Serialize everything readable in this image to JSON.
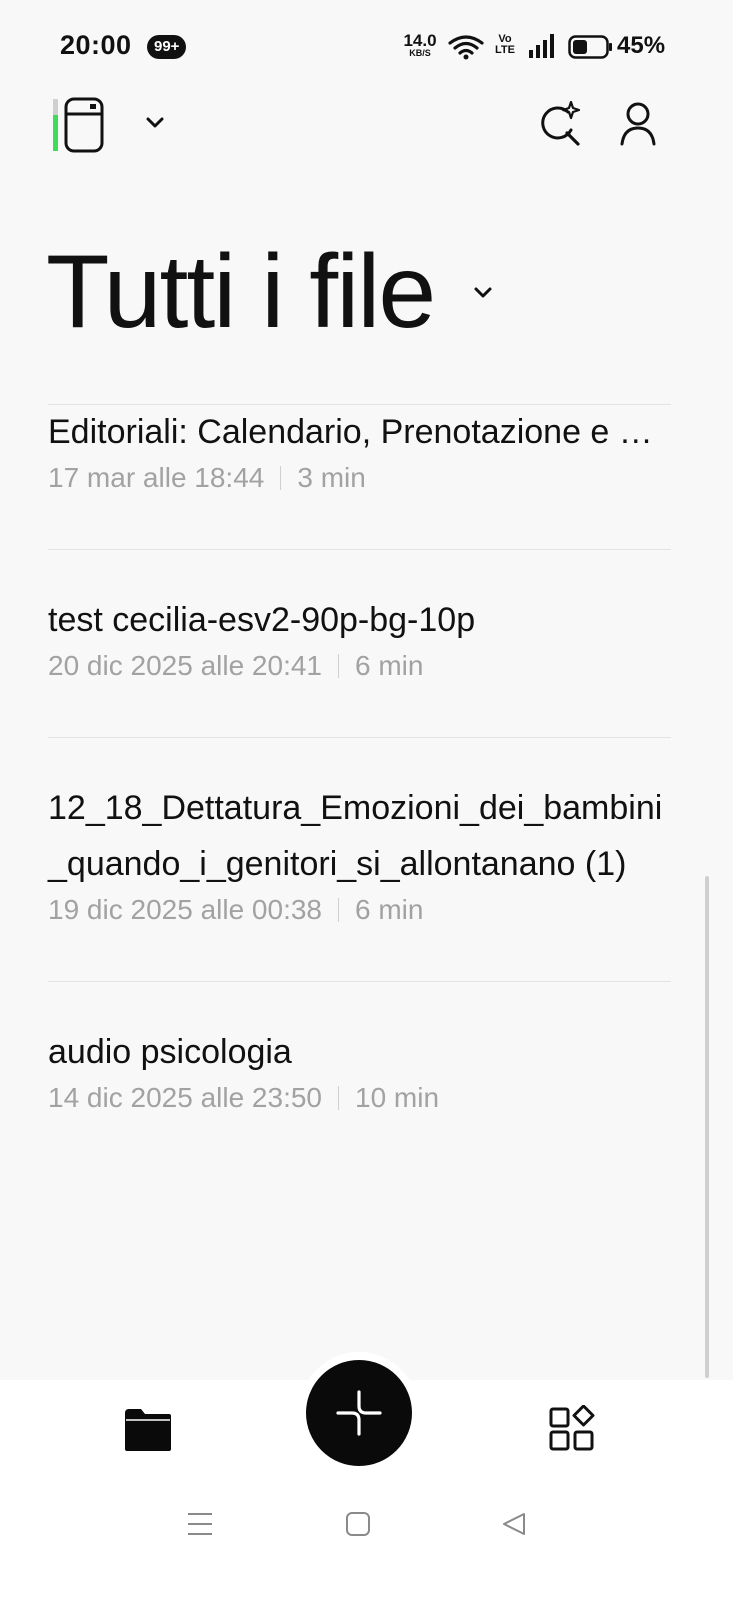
{
  "status_bar": {
    "time": "20:00",
    "notification_badge": "99+",
    "net_speed_value": "14.0",
    "net_speed_unit": "KB/S",
    "volte_top": "Vo",
    "volte_bottom": "LTE",
    "battery_percent": "45%",
    "battery_level": 0.45,
    "icons": [
      "wifi-icon",
      "signal-icon",
      "battery-icon"
    ]
  },
  "header": {
    "logo_icon": "app-logo-icon",
    "dropdown_icon": "chevron-down-icon",
    "search_icon": "sparkle-search-icon",
    "profile_icon": "profile-icon"
  },
  "page": {
    "title": "Tutti i file",
    "title_dropdown_icon": "chevron-down-icon"
  },
  "files": [
    {
      "name": "Editoriali: Calendario, Prenotazione e …",
      "date": "17 mar alle 18:44",
      "duration": "3 min"
    },
    {
      "name": "test cecilia-esv2-90p-bg-10p",
      "date": "20 dic 2025 alle 20:41",
      "duration": "6 min"
    },
    {
      "name": "12_18_Dettatura_Emozioni_dei_bambini_quando_i_genitori_si_allontanano (1)",
      "date": "19 dic 2025 alle 00:38",
      "duration": "6 min"
    },
    {
      "name": "audio psicologia",
      "date": "14 dic 2025 alle 23:50",
      "duration": "10 min"
    }
  ],
  "bottom_nav": {
    "left_icon": "folder-icon",
    "fab_icon": "sparkle-plus-icon",
    "right_icon": "apps-grid-icon"
  },
  "system_nav": [
    "menu-icon",
    "home-icon",
    "back-icon"
  ],
  "colors": {
    "background": "#f8f8f8",
    "text": "#111111",
    "meta_text": "#a2a2a2",
    "divider": "#e3e3e3",
    "accent_green": "#3ddc5a",
    "fab": "#0a0a0a"
  }
}
